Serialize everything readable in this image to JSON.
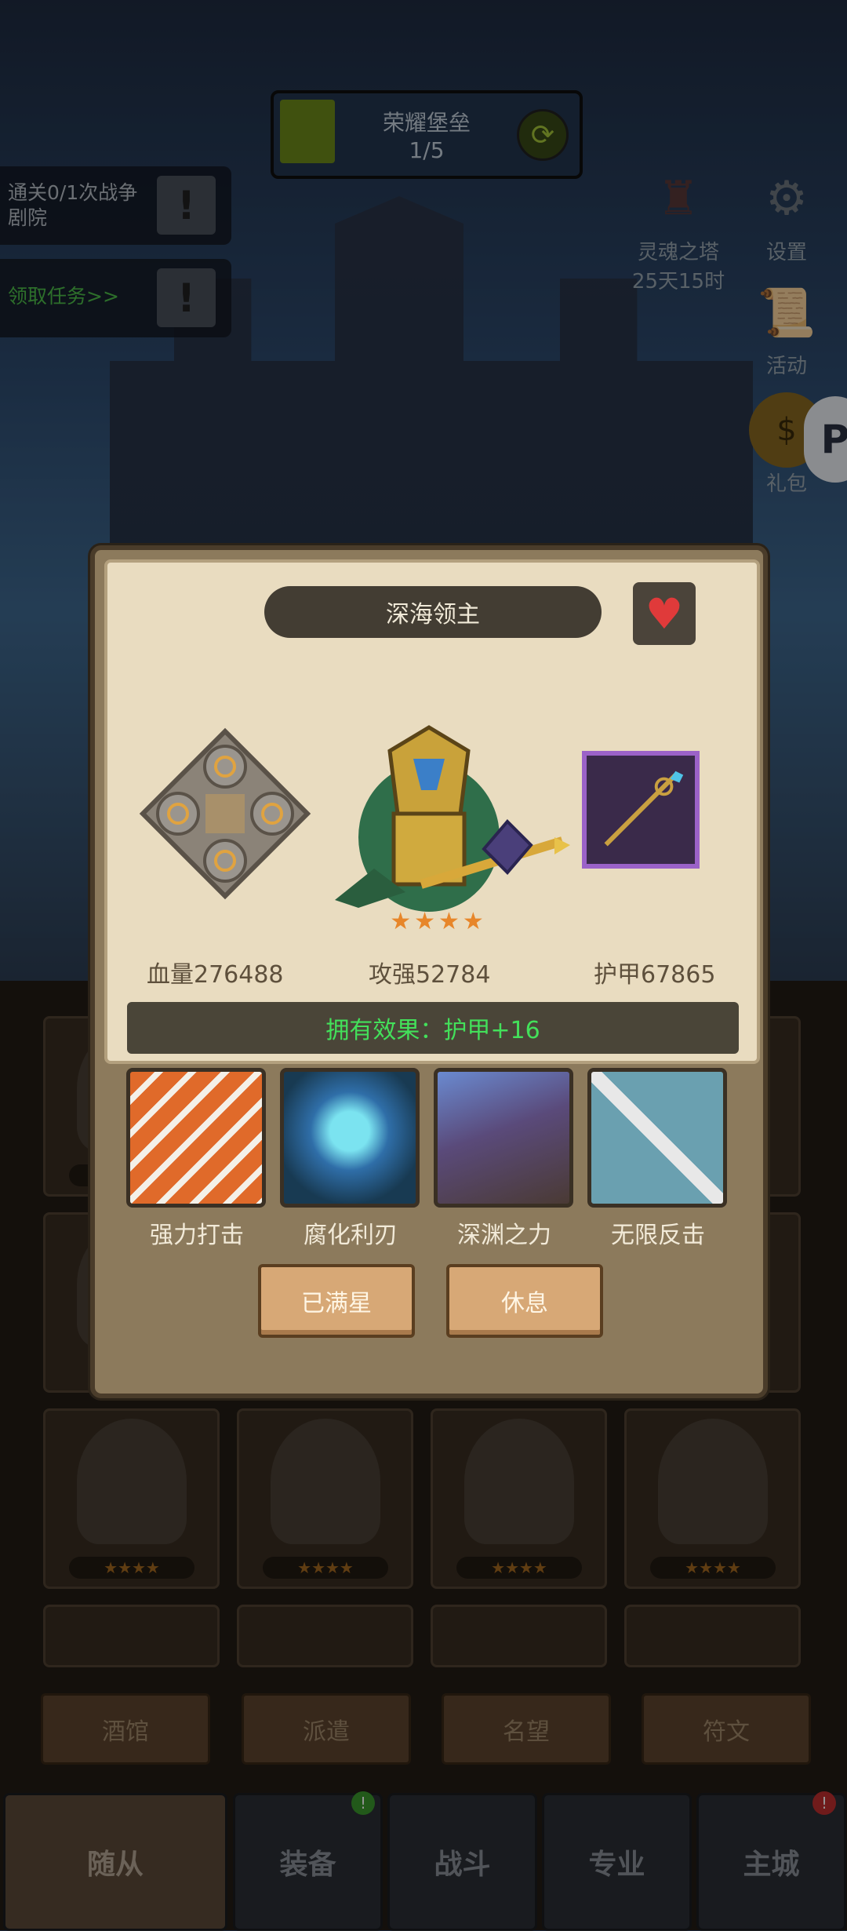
{
  "hud": {
    "stage_title": "荣耀堡垒",
    "stage_progress_text": "1/5",
    "stage_progress": 0.2,
    "quests": [
      {
        "text": "通关0/1次战争剧院"
      },
      {
        "text": "领取任务>>"
      }
    ],
    "soul_tower": {
      "label": "灵魂之塔",
      "timer": "25天15时"
    },
    "settings_label": "设置",
    "activity_label": "活动",
    "gift_label": "礼包"
  },
  "hero_panel": {
    "name": "深海领主",
    "stars": 4,
    "stats": {
      "hp": "血量276488",
      "attack": "攻强52784",
      "armor": "护甲67865"
    },
    "effect": "拥有效果：护甲+16",
    "skills": [
      {
        "name": "强力打击"
      },
      {
        "name": "腐化利刃"
      },
      {
        "name": "深渊之力"
      },
      {
        "name": "无限反击"
      }
    ],
    "buttons": {
      "max_star": "已满星",
      "rest": "休息"
    }
  },
  "colors": {
    "effect_text": "#43e05a",
    "star": "#e7862a",
    "weapon_border": "#9b62c8",
    "heart": "#e03a3a"
  },
  "sub_tabs": [
    "酒馆",
    "派遣",
    "名望",
    "符文"
  ],
  "nav": [
    {
      "label": "随从"
    },
    {
      "label": "装备"
    },
    {
      "label": "战斗"
    },
    {
      "label": "专业"
    },
    {
      "label": "主城"
    }
  ]
}
